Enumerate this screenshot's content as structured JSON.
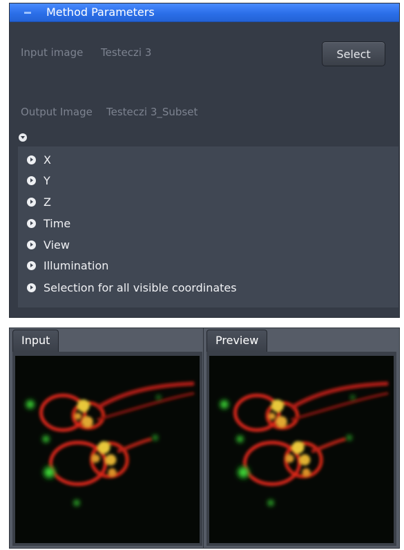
{
  "method_parameters": {
    "title": "Method Parameters",
    "input_label": "Input image",
    "input_value": "Testeczi 3",
    "select_label": "Select",
    "output_label": "Output Image",
    "output_value": "Testeczi 3_Subset",
    "coordinates": [
      {
        "label": "X"
      },
      {
        "label": "Y"
      },
      {
        "label": "Z"
      },
      {
        "label": "Time"
      },
      {
        "label": "View"
      },
      {
        "label": "Illumination"
      },
      {
        "label": "Selection for all visible coordinates"
      }
    ]
  },
  "viewers": {
    "input_tab": "Input",
    "preview_tab": "Preview"
  },
  "colors": {
    "header_blue": "#2b6fe8",
    "panel_bg": "#353b46",
    "membrane_red": "#e0281a",
    "fluor_green": "#38d038"
  },
  "icons": {
    "collapse": "minus-icon",
    "section_toggle": "chevron-down-circle-icon",
    "coordinate_expand": "chevron-right-circle-icon"
  }
}
